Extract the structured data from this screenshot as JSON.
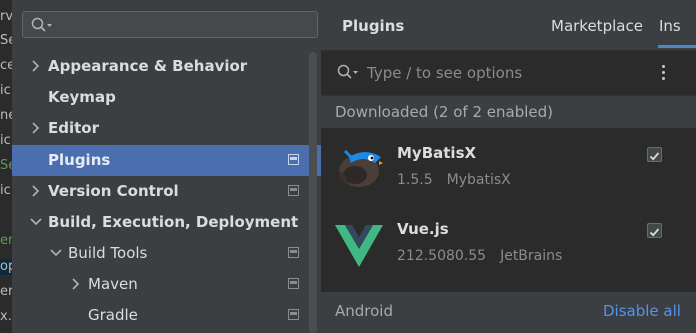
{
  "editor_strip": {
    "fragments": [
      "rv",
      "Se",
      "ce",
      "ic",
      "ne",
      "ic",
      "Se",
      "ic",
      "er.",
      "op",
      "er",
      "x.x"
    ]
  },
  "sidebar": {
    "search": {
      "placeholder": ""
    },
    "items": [
      {
        "label": "Appearance & Behavior",
        "expandable": true,
        "expanded": false,
        "project_icon": false
      },
      {
        "label": "Keymap",
        "expandable": false,
        "project_icon": false
      },
      {
        "label": "Editor",
        "expandable": true,
        "expanded": false,
        "project_icon": false
      },
      {
        "label": "Plugins",
        "expandable": false,
        "project_icon": true,
        "selected": true
      },
      {
        "label": "Version Control",
        "expandable": true,
        "expanded": false,
        "project_icon": true
      },
      {
        "label": "Build, Execution, Deployment",
        "expandable": true,
        "expanded": true,
        "project_icon": false
      },
      {
        "label": "Build Tools",
        "expandable": true,
        "expanded": true,
        "project_icon": true
      },
      {
        "label": "Maven",
        "expandable": true,
        "expanded": false,
        "project_icon": true
      },
      {
        "label": "Gradle",
        "expandable": false,
        "project_icon": true
      }
    ]
  },
  "header": {
    "title": "Plugins",
    "tabs": [
      {
        "label": "Marketplace",
        "active": false
      },
      {
        "label": "Ins",
        "active": true
      }
    ]
  },
  "plugin_search": {
    "placeholder": "Type / to see options"
  },
  "downloaded_section": {
    "label": "Downloaded (2 of 2 enabled)"
  },
  "plugins": [
    {
      "name": "MyBatisX",
      "version": "1.5.5",
      "vendor": "MybatisX",
      "enabled": true,
      "icon": "mybatisx-bird-icon"
    },
    {
      "name": "Vue.js",
      "version": "212.5080.55",
      "vendor": "JetBrains",
      "enabled": true,
      "icon": "vue-logo-icon"
    }
  ],
  "android_section": {
    "label": "Android",
    "action": "Disable all"
  },
  "colors": {
    "selection": "#4b6eaf",
    "link": "#5394ec",
    "tab_underline": "#4a88c7",
    "vue_green": "#41b883",
    "vue_dark": "#34495e"
  }
}
